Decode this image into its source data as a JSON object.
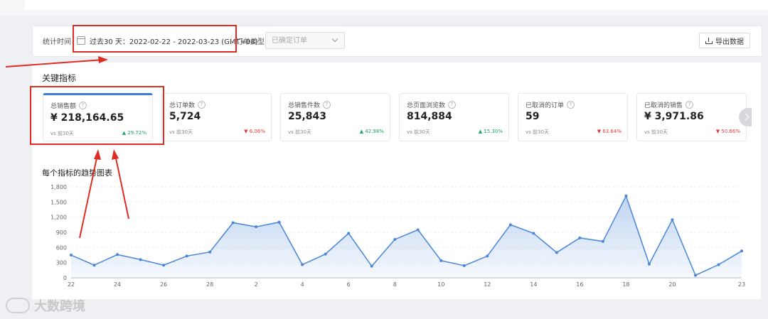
{
  "filter": {
    "time_label": "统计时间",
    "date_range": "过去30 天：2022-02-22 - 2022-03-23 (GMT+08)",
    "order_type_label": "订单类型",
    "order_type_value": "已确定订单",
    "export_label": "导出数据"
  },
  "section_title": "关键指标",
  "cards": [
    {
      "name": "总销售额",
      "value": "¥ 218,164.65",
      "compare": "vs 前30天",
      "change": "▲ 29.72%",
      "trend": "up"
    },
    {
      "name": "总订单数",
      "value": "5,724",
      "compare": "vs 前30天",
      "change": "▼ 6.06%",
      "trend": "down"
    },
    {
      "name": "总销售件数",
      "value": "25,843",
      "compare": "vs 前30天",
      "change": "▲ 42.98%",
      "trend": "up"
    },
    {
      "name": "总页面浏览数",
      "value": "814,884",
      "compare": "vs 前30天",
      "change": "▲ 15.30%",
      "trend": "up"
    },
    {
      "name": "已取消的订单",
      "value": "59",
      "compare": "vs 前30天",
      "change": "▼ 63.64%",
      "trend": "down"
    },
    {
      "name": "已取消的销售",
      "value": "¥ 3,971.86",
      "compare": "vs 前30天",
      "change": "▼ 50.66%",
      "trend": "down"
    }
  ],
  "chart_title": "每个指标的趋势图表",
  "chart_data": {
    "type": "area",
    "title": "",
    "xlabel": "",
    "ylabel": "",
    "ylim": [
      0,
      1800
    ],
    "yticks": [
      "0",
      "300",
      "600",
      "900",
      "1,200",
      "1,500",
      "1,800"
    ],
    "xticks": [
      "22",
      "24",
      "26",
      "28",
      "2",
      "4",
      "6",
      "8",
      "10",
      "12",
      "14",
      "16",
      "18",
      "20",
      "23"
    ],
    "x": [
      "22",
      "23",
      "24",
      "25",
      "26",
      "27",
      "28",
      "1",
      "2",
      "3",
      "4",
      "5",
      "6",
      "7",
      "8",
      "9",
      "10",
      "11",
      "12",
      "13",
      "14",
      "15",
      "16",
      "17",
      "18",
      "19",
      "20",
      "21",
      "22",
      "23"
    ],
    "values": [
      450,
      250,
      460,
      360,
      250,
      430,
      510,
      1090,
      1010,
      1100,
      260,
      470,
      880,
      230,
      760,
      950,
      340,
      240,
      430,
      1050,
      880,
      500,
      790,
      720,
      1620,
      270,
      1150,
      50,
      260,
      530
    ],
    "color": "#4a86d8",
    "grid": true
  },
  "watermark": "大数跨境",
  "colors": {
    "accent": "#3b7ddb",
    "up": "#21a366",
    "down": "#e03b3b",
    "annotation": "#e02d24"
  }
}
